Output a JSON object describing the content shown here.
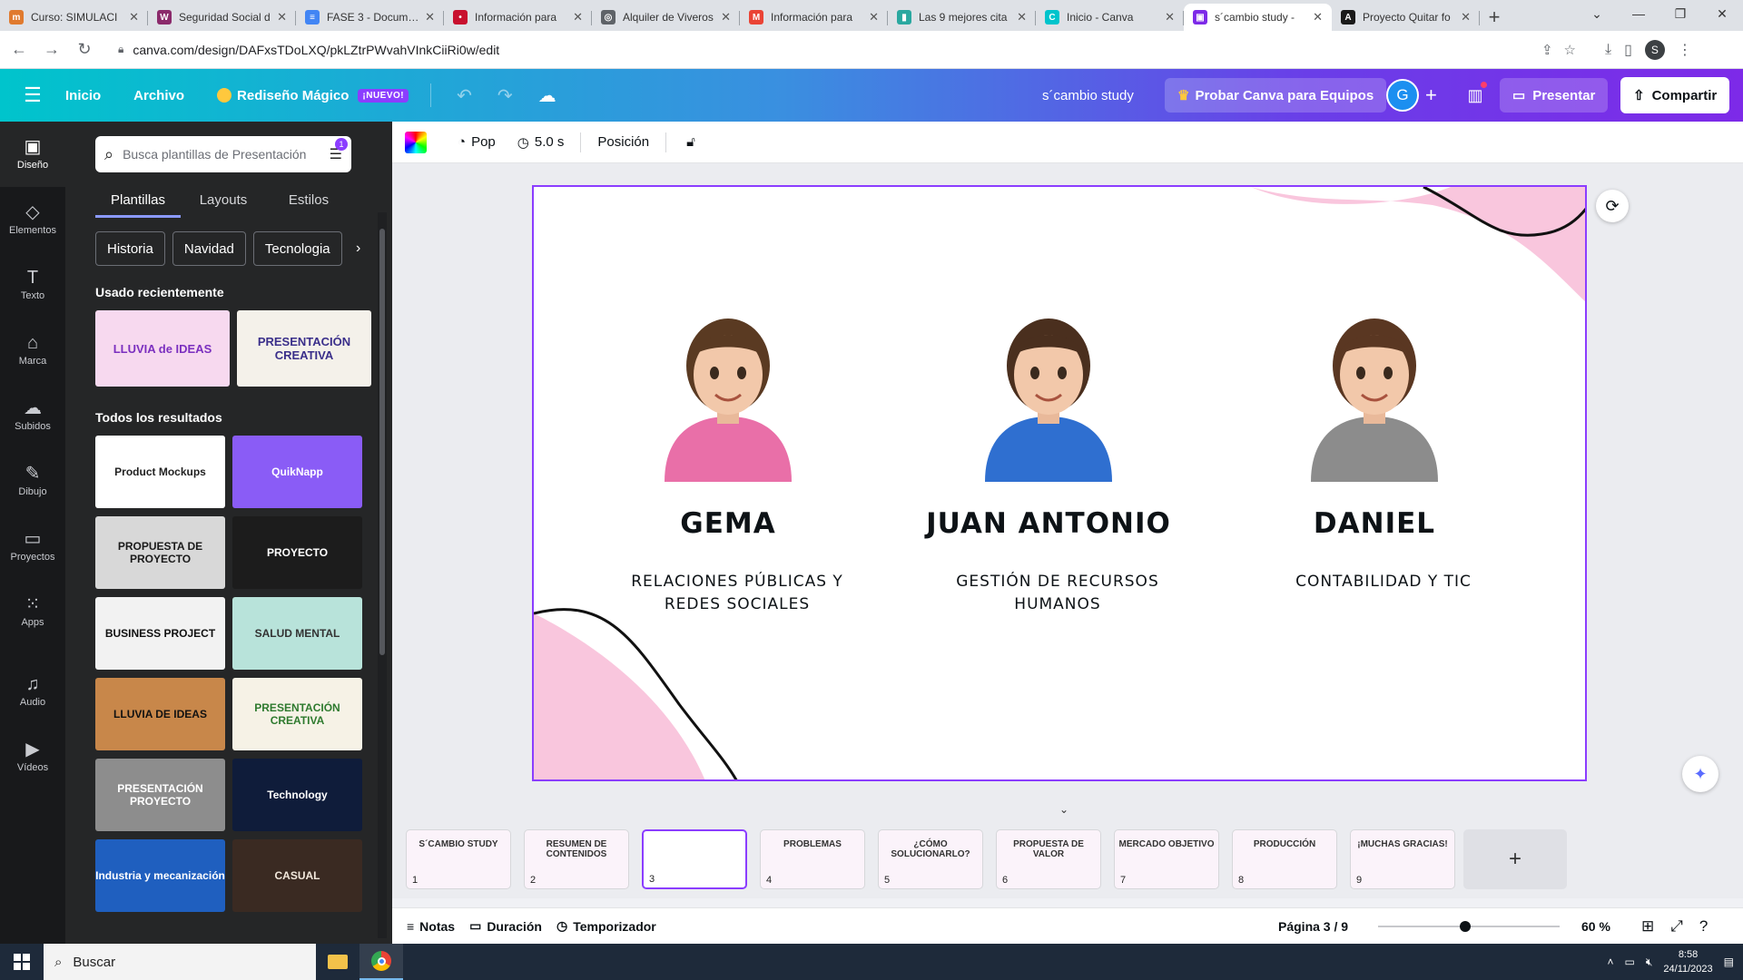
{
  "browser": {
    "tabs": [
      {
        "title": "Curso: SIMULACI",
        "fav_color": "#e07a2e",
        "fav_glyph": "m"
      },
      {
        "title": "Seguridad Social d",
        "fav_color": "#8b2a6b",
        "fav_glyph": "W"
      },
      {
        "title": "FASE 3 - Documen",
        "fav_color": "#4285f4",
        "fav_glyph": "≡"
      },
      {
        "title": "Información para",
        "fav_color": "#c8102e",
        "fav_glyph": "•"
      },
      {
        "title": "Alquiler de Viveros",
        "fav_color": "#5f6368",
        "fav_glyph": "◎"
      },
      {
        "title": "Información para",
        "fav_color": "#ea4335",
        "fav_glyph": "M"
      },
      {
        "title": "Las 9 mejores cita",
        "fav_color": "#2aa8a0",
        "fav_glyph": "▮"
      },
      {
        "title": "Inicio - Canva",
        "fav_color": "#00c4cc",
        "fav_glyph": "C"
      },
      {
        "title": "s´cambio study - ",
        "fav_color": "#7d2ae8",
        "fav_glyph": "▣",
        "active": true
      },
      {
        "title": "Proyecto Quitar fo",
        "fav_color": "#1a1a1a",
        "fav_glyph": "A"
      }
    ],
    "url": "canva.com/design/DAFxsTDoLXQ/pkLZtrPWvahVInkCiiRi0w/edit",
    "profile_initial": "S"
  },
  "canva": {
    "menu": {
      "home": "Inicio",
      "file": "Archivo",
      "magic": "Rediseño Mágico",
      "new_badge": "¡NUEVO!"
    },
    "doc_title": "s´cambio study",
    "teams_button": "Probar Canva para Equipos",
    "avatar_initial": "G",
    "present_button": "Presentar",
    "share_button": "Compartir",
    "rail": [
      {
        "label": "Diseño",
        "icon": "layout-icon",
        "glyph": "▣"
      },
      {
        "label": "Elementos",
        "icon": "shapes-icon",
        "glyph": "◇"
      },
      {
        "label": "Texto",
        "icon": "text-icon",
        "glyph": "T"
      },
      {
        "label": "Marca",
        "icon": "brand-icon",
        "glyph": "⌂"
      },
      {
        "label": "Subidos",
        "icon": "upload-icon",
        "glyph": "☁"
      },
      {
        "label": "Dibujo",
        "icon": "draw-icon",
        "glyph": "✎"
      },
      {
        "label": "Proyectos",
        "icon": "folder-icon",
        "glyph": "▭"
      },
      {
        "label": "Apps",
        "icon": "apps-icon",
        "glyph": "⁙"
      },
      {
        "label": "Audio",
        "icon": "audio-icon",
        "glyph": "♫"
      },
      {
        "label": "Vídeos",
        "icon": "video-icon",
        "glyph": "▶"
      }
    ],
    "panel": {
      "search_placeholder": "Busca plantillas de Presentación",
      "filter_badge": "1",
      "tabs": [
        "Plantillas",
        "Layouts",
        "Estilos"
      ],
      "chips": [
        "Historia",
        "Navidad",
        "Tecnologia"
      ],
      "recent_title": "Usado recientemente",
      "recent": [
        {
          "text": "LLUVIA de IDEAS",
          "bg": "#f7d9ef",
          "fg": "#7b2fbf"
        },
        {
          "text": "PRESENTACIÓN CREATIVA",
          "bg": "#f4f1ea",
          "fg": "#3a2f8a"
        }
      ],
      "all_title": "Todos los resultados",
      "results": [
        {
          "text": "Product Mockups",
          "bg": "#ffffff",
          "fg": "#222222"
        },
        {
          "text": "QuikNapp",
          "bg": "#8a5cf6",
          "fg": "#ffffff"
        },
        {
          "text": "PROPUESTA DE PROYECTO",
          "bg": "#d8d8d8",
          "fg": "#1a1a1a"
        },
        {
          "text": "PROYECTO",
          "bg": "#1c1c1c",
          "fg": "#ffffff"
        },
        {
          "text": "BUSINESS PROJECT",
          "bg": "#f2f2f2",
          "fg": "#111111"
        },
        {
          "text": "SALUD MENTAL",
          "bg": "#b8e3da",
          "fg": "#333333"
        },
        {
          "text": "LLUVIA DE IDEAS",
          "bg": "#c8874a",
          "fg": "#111111"
        },
        {
          "text": "PRESENTACIÓN CREATIVA",
          "bg": "#f6f2e6",
          "fg": "#2e7a2e"
        },
        {
          "text": "PRESENTACIÓN PROYECTO",
          "bg": "#8d8d8d",
          "fg": "#ffffff"
        },
        {
          "text": "Technology",
          "bg": "#0f1c3a",
          "fg": "#ffffff"
        },
        {
          "text": "Industria y mecanización",
          "bg": "#1f5fbf",
          "fg": "#ffffff"
        },
        {
          "text": "CASUAL",
          "bg": "#3a2a22",
          "fg": "#f2e8dc"
        }
      ]
    },
    "toolbar": {
      "animation": "Pop",
      "duration": "5.0 s",
      "position": "Posición"
    },
    "slide": {
      "members": [
        {
          "name": "GEMA",
          "role_line1": "RELACIONES PÚBLICAS Y",
          "role_line2": "REDES SOCIALES",
          "shirt": "#e96fa8",
          "hair": "#5a3a22"
        },
        {
          "name": "JUAN ANTONIO",
          "role_line1": "GESTIÓN DE RECURSOS",
          "role_line2": "HUMANOS",
          "shirt": "#2f6fd0",
          "hair": "#4a2f1e"
        },
        {
          "name": "DANIEL",
          "role_line1": "CONTABILIDAD Y TIC",
          "role_line2": "",
          "shirt": "#8c8c8c",
          "hair": "#5a3722"
        }
      ],
      "accent_pink": "#f9c6dd"
    },
    "pages": [
      {
        "num": "1",
        "label": "S´CAMBIO STUDY"
      },
      {
        "num": "2",
        "label": "RESUMEN DE CONTENIDOS"
      },
      {
        "num": "3",
        "label": ""
      },
      {
        "num": "4",
        "label": "PROBLEMAS"
      },
      {
        "num": "5",
        "label": "¿CÓMO SOLUCIONARLO?"
      },
      {
        "num": "6",
        "label": "PROPUESTA DE VALOR"
      },
      {
        "num": "7",
        "label": "MERCADO OBJETIVO"
      },
      {
        "num": "8",
        "label": "PRODUCCIÓN"
      },
      {
        "num": "9",
        "label": "¡MUCHAS GRACIAS!"
      }
    ],
    "footer": {
      "notes": "Notas",
      "duration": "Duración",
      "timer": "Temporizador",
      "page_indicator": "Página 3 / 9",
      "zoom": "60 %",
      "zoom_level": 0.6
    }
  },
  "taskbar": {
    "search_placeholder": "Buscar",
    "time": "8:58",
    "date": "24/11/2023"
  }
}
